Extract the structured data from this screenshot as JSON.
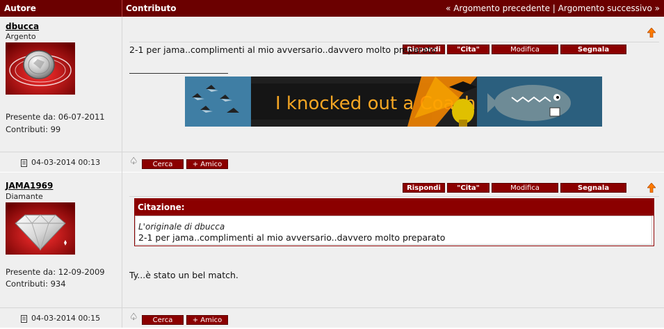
{
  "header": {
    "author_col": "Autore",
    "content_col": "Contributo",
    "prev_arrow": "«",
    "prev_label": "Argomento precedente",
    "separator": "|",
    "next_label": "Argomento successivo",
    "next_arrow": "»"
  },
  "buttons": {
    "reply": "Rispondi",
    "quote": "\"Cita\"",
    "edit": "Modifica",
    "report": "Segnala",
    "search": "Cerca",
    "friend": "+ Amico"
  },
  "posts": [
    {
      "username": "dbucca",
      "rank": "Argento",
      "since": "Presente da: 06-07-2011",
      "count": "Contributi: 99",
      "date": "04-03-2014 00:13",
      "text": "2-1 per jama..complimenti al mio avversario..davvero molto preparato",
      "banner_text": "I knocked out a Coach"
    },
    {
      "username": "JAMA1969",
      "rank": "Diamante",
      "since": "Presente da: 12-09-2009",
      "count": "Contributi: 934",
      "date": "04-03-2014 00:15",
      "quote_header": "Citazione:",
      "quote_author": "L'originale di dbucca",
      "quote_text": "2-1 per jama..complimenti al mio avversario..davvero molto preparato",
      "text": "Ty...è stato un bel match."
    }
  ],
  "colors": {
    "header": "#6b0000",
    "button": "#8b0000",
    "row_bg": "#efefef"
  }
}
